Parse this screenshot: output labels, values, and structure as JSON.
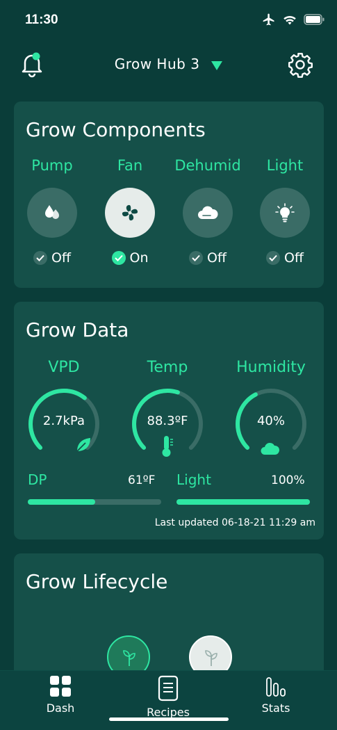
{
  "status_bar": {
    "time": "11:30"
  },
  "header": {
    "hub_name": "Grow Hub 3"
  },
  "components": {
    "title": "Grow Components",
    "items": [
      {
        "label": "Pump",
        "state": "Off",
        "icon": "water-drop-icon"
      },
      {
        "label": "Fan",
        "state": "On",
        "icon": "fan-icon"
      },
      {
        "label": "Dehumid",
        "state": "Off",
        "icon": "cloud-icon"
      },
      {
        "label": "Light",
        "state": "Off",
        "icon": "light-bulb-icon"
      }
    ]
  },
  "grow_data": {
    "title": "Grow Data",
    "gauges": [
      {
        "label": "VPD",
        "value": "2.7kPa",
        "icon": "leaf-icon"
      },
      {
        "label": "Temp",
        "value": "88.3ºF",
        "icon": "thermometer-icon"
      },
      {
        "label": "Humidity",
        "value": "40%",
        "icon": "cloud-icon"
      }
    ],
    "dp": {
      "label": "DP",
      "value": "61ºF"
    },
    "light": {
      "label": "Light",
      "value": "100%"
    },
    "last_updated": "Last updated 06-18-21 11:29 am"
  },
  "lifecycle": {
    "title": "Grow Lifecycle"
  },
  "nav": {
    "dash": "Dash",
    "recipes": "Recipes",
    "stats": "Stats"
  },
  "colors": {
    "background": "#0a3d39",
    "card": "#155049",
    "accent": "#2ee6a2",
    "muted": "#3a6c66"
  }
}
